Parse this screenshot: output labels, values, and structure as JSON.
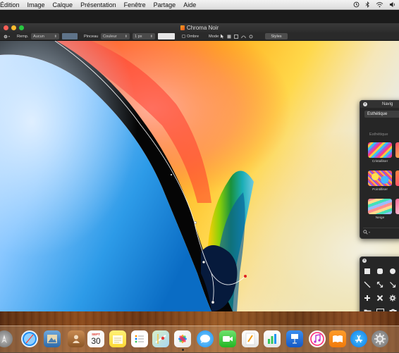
{
  "menubar": {
    "items": [
      "Édition",
      "Image",
      "Calque",
      "Présentation",
      "Fenêtre",
      "Partage",
      "Aide"
    ],
    "status_icons": [
      "time-machine-icon",
      "bluetooth-icon",
      "wifi-icon",
      "volume-icon"
    ]
  },
  "window": {
    "title": "Chroma Noir"
  },
  "toolbar": {
    "fill_label": "Remp.",
    "fill_value": "Aucun",
    "fill_color": "#5e7389",
    "brush_label": "Pinceau",
    "brush_value": "Couleur",
    "stroke_width": "1 px",
    "stroke_color": "#e6e6e6",
    "shadow_label": "Ombre",
    "mode_label": "Mode",
    "styles_label": "Styles"
  },
  "navigator": {
    "title": "Navig",
    "dropdown_value": "Esthétique",
    "section": "Esthétique",
    "items": [
      {
        "label": "Cristalliser"
      },
      {
        "label": "Pointilliser"
      },
      {
        "label": "Neige"
      }
    ],
    "partial_label": "N"
  },
  "shapes_palette": {
    "tools": [
      "square-shape-icon",
      "rounded-rect-shape-icon",
      "circle-shape-icon",
      "line-icon",
      "double-arrow-icon",
      "arrow-icon",
      "plus-icon",
      "close-x-icon",
      "gear-icon",
      "folder-icon",
      "image-icon",
      "camera-icon"
    ]
  },
  "dock": {
    "calendar_month": "SEPT",
    "calendar_day": "30",
    "apps": [
      "launchpad-icon",
      "safari-icon",
      "preview-icon",
      "contacts-icon",
      "calendar-icon",
      "notes-icon",
      "reminders-icon",
      "maps-icon",
      "photos-icon",
      "messages-icon",
      "facetime-icon",
      "pages-icon",
      "numbers-icon",
      "keynote-icon",
      "itunes-icon",
      "ibooks-icon",
      "app-store-icon",
      "system-preferences-icon"
    ]
  }
}
